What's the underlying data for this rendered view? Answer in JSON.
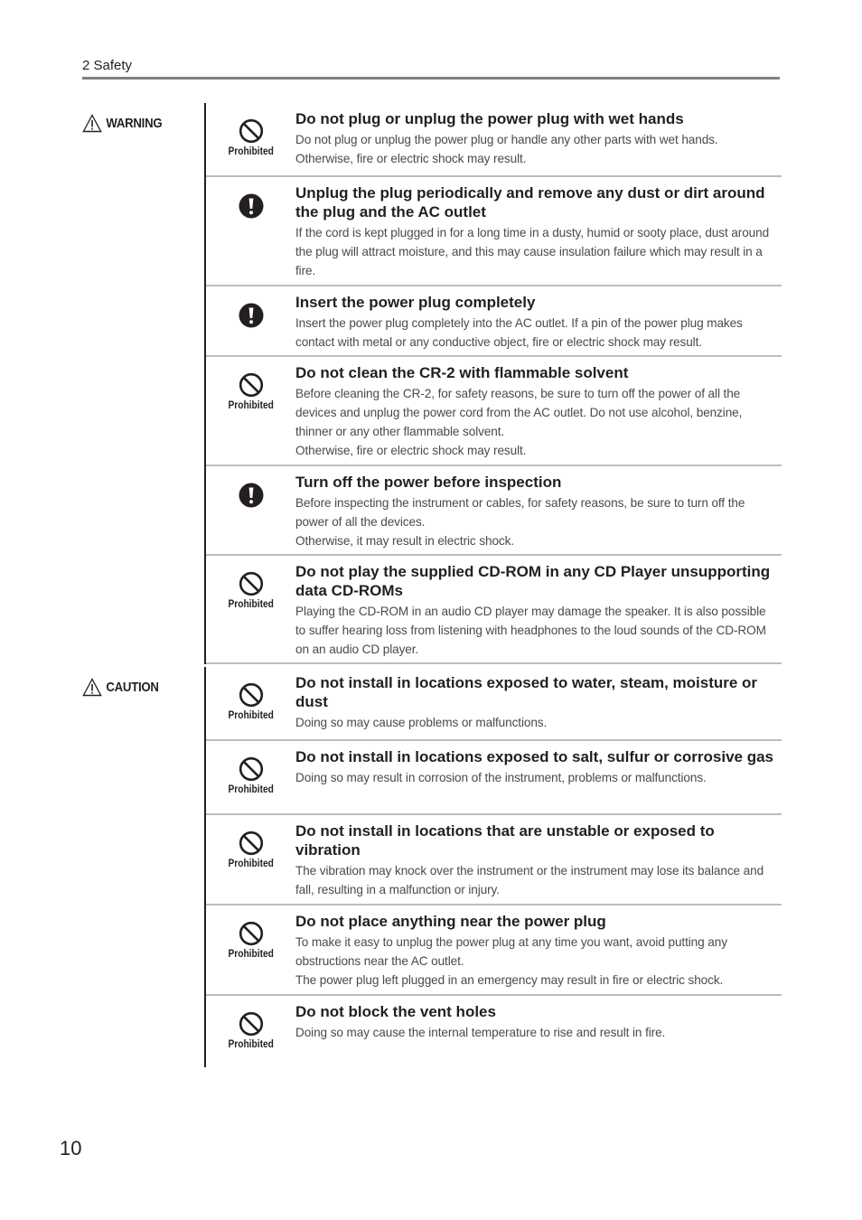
{
  "header": {
    "title": "2 Safety"
  },
  "warning": {
    "label": "WARNING",
    "rows": [
      {
        "icon": "prohibited-icon",
        "icon_label": "Prohibited",
        "title": "Do not plug or unplug the power plug with wet hands",
        "description": "Do not plug or unplug the power plug or handle any other parts with wet hands.\nOtherwise, fire or electric shock may result."
      },
      {
        "icon": "mandatory-icon",
        "icon_label": "",
        "title": "Unplug the plug periodically and remove any dust or dirt around the plug and the AC outlet",
        "description": "If the cord is kept plugged in for a long time in a dusty, humid or sooty place, dust around the plug will attract moisture, and this may cause insulation failure which may result in a fire."
      },
      {
        "icon": "mandatory-icon",
        "icon_label": "",
        "title": "Insert the power plug completely",
        "description": "Insert the power plug completely into the AC outlet. If a pin of the power plug makes contact with metal or any conductive object, fire or electric shock may result."
      },
      {
        "icon": "prohibited-icon",
        "icon_label": "Prohibited",
        "title": "Do not clean the CR-2 with flammable solvent",
        "description": "Before cleaning the CR-2, for safety reasons, be sure to turn off the power of all the devices and unplug the power cord from the AC outlet. Do not use alcohol, benzine, thinner or any other flammable solvent.\nOtherwise, fire or electric shock may result."
      },
      {
        "icon": "mandatory-icon",
        "icon_label": "",
        "title": "Turn off the power before inspection",
        "description": "Before inspecting the instrument or cables, for safety reasons, be sure to turn off the power of all the devices.\nOtherwise, it may result in electric shock."
      },
      {
        "icon": "prohibited-icon",
        "icon_label": "Prohibited",
        "title": "Do not play the supplied CD-ROM in any CD Player unsupporting data CD-ROMs",
        "description": "Playing the CD-ROM in an audio CD player may damage the speaker. It is also possible to suffer hearing loss from listening with headphones to the loud sounds of the CD-ROM on an audio CD player."
      }
    ]
  },
  "caution": {
    "label": "CAUTION",
    "rows": [
      {
        "icon": "prohibited-icon",
        "icon_label": "Prohibited",
        "title": "Do not install in locations exposed to water, steam, moisture or dust",
        "description": "Doing so may cause problems or malfunctions."
      },
      {
        "icon": "prohibited-icon",
        "icon_label": "Prohibited",
        "title": "Do not install in locations exposed to salt, sulfur or corrosive gas",
        "description": "Doing so may result in corrosion of the instrument, problems or malfunctions."
      },
      {
        "icon": "prohibited-icon",
        "icon_label": "Prohibited",
        "title": "Do not install in locations that are unstable or exposed to vibration",
        "description": "The vibration may knock over the instrument or the instrument may lose its balance and fall, resulting in a malfunction or injury."
      },
      {
        "icon": "prohibited-icon",
        "icon_label": "Prohibited",
        "title": "Do not place anything near the power plug",
        "description": "To make it easy to unplug the power plug at any time you want, avoid putting any obstructions near the AC outlet.\nThe power plug left plugged in an emergency may result in fire or electric shock."
      },
      {
        "icon": "prohibited-icon",
        "icon_label": "Prohibited",
        "title": "Do not block the vent holes",
        "description": "Doing so may cause the internal temperature to rise and result in fire."
      }
    ]
  },
  "footer": {
    "page_number": "10"
  },
  "colors": {
    "text": "#231f20",
    "rule": "#808080",
    "divider": "#bdbdbd",
    "body_text": "#4a4a4a"
  }
}
